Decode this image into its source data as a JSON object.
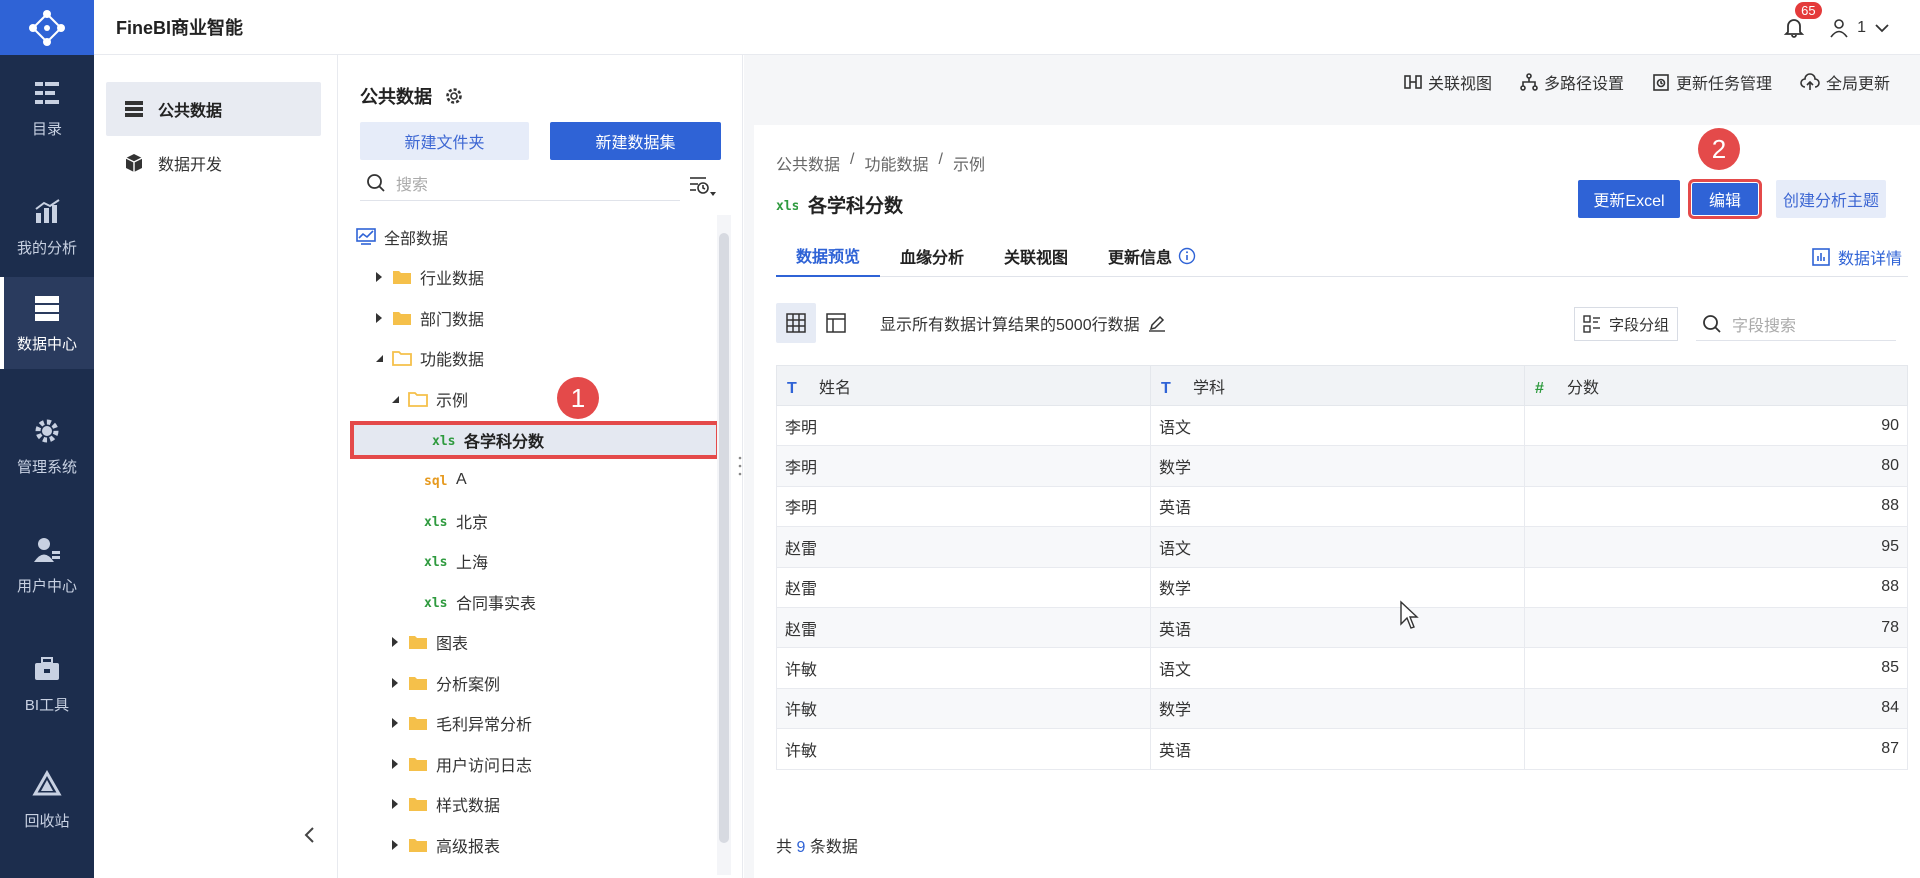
{
  "app": {
    "brand": "FineBI商业智能",
    "notifications": "65",
    "user": "1"
  },
  "rail": [
    {
      "label": "目录",
      "icon": "catalog-icon"
    },
    {
      "label": "我的分析",
      "icon": "analysis-icon"
    },
    {
      "label": "数据中心",
      "icon": "data-center-icon",
      "active": true
    },
    {
      "label": "管理系统",
      "icon": "gear-icon"
    },
    {
      "label": "用户中心",
      "icon": "user-icon"
    },
    {
      "label": "BI工具",
      "icon": "toolbox-icon"
    },
    {
      "label": "回收站",
      "icon": "recycle-icon"
    }
  ],
  "subnav": {
    "items": [
      {
        "label": "公共数据"
      },
      {
        "label": "数据开发"
      }
    ]
  },
  "tree": {
    "title": "公共数据",
    "new_folder": "新建文件夹",
    "new_dataset": "新建数据集",
    "search_placeholder": "搜索",
    "rows": [
      {
        "label": "全部数据"
      },
      {
        "label": "行业数据"
      },
      {
        "label": "部门数据"
      },
      {
        "label": "功能数据"
      },
      {
        "label": "示例"
      },
      {
        "label": "各学科分数"
      },
      {
        "label": "A",
        "tag": "SQL"
      },
      {
        "label": "北京",
        "tag": "XLS"
      },
      {
        "label": "上海",
        "tag": "XLS"
      },
      {
        "label": "合同事实表",
        "tag": "XLS"
      },
      {
        "label": "图表"
      },
      {
        "label": "分析案例"
      },
      {
        "label": "毛利异常分析"
      },
      {
        "label": "用户访问日志"
      },
      {
        "label": "样式数据"
      },
      {
        "label": "高级报表"
      }
    ]
  },
  "content": {
    "actions": {
      "a1": "关联视图",
      "a2": "多路径设置",
      "a3": "更新任务管理",
      "a4": "全局更新"
    },
    "breadcrumb": [
      "公共数据",
      "功能数据",
      "示例"
    ],
    "title": "各学科分数",
    "buttons": {
      "update_excel": "更新Excel",
      "edit": "编辑",
      "create_topic": "创建分析主题"
    },
    "tabs": [
      "数据预览",
      "血缘分析",
      "关联视图",
      "更新信息"
    ],
    "detail_link": "数据详情",
    "note": "显示所有数据计算结果的5000行数据",
    "group_btn": "字段分组",
    "field_search_placeholder": "字段搜索",
    "columns": [
      "姓名",
      "学科",
      "分数"
    ],
    "rows": [
      [
        "李明",
        "语文",
        "90"
      ],
      [
        "李明",
        "数学",
        "80"
      ],
      [
        "李明",
        "英语",
        "88"
      ],
      [
        "赵雷",
        "语文",
        "95"
      ],
      [
        "赵雷",
        "数学",
        "88"
      ],
      [
        "赵雷",
        "英语",
        "78"
      ],
      [
        "许敏",
        "语文",
        "85"
      ],
      [
        "许敏",
        "数学",
        "84"
      ],
      [
        "许敏",
        "英语",
        "87"
      ]
    ],
    "count_prefix": "共",
    "count_value": "9",
    "count_suffix": "条数据"
  },
  "markers": {
    "m1": "1",
    "m2": "2"
  },
  "colors": {
    "rail": "#1c2d4d",
    "primary": "#2f63d6",
    "marker": "#e44a4a",
    "xls": "#2e9a3e",
    "sql": "#e69a1f",
    "folder": "#f5c04a"
  }
}
